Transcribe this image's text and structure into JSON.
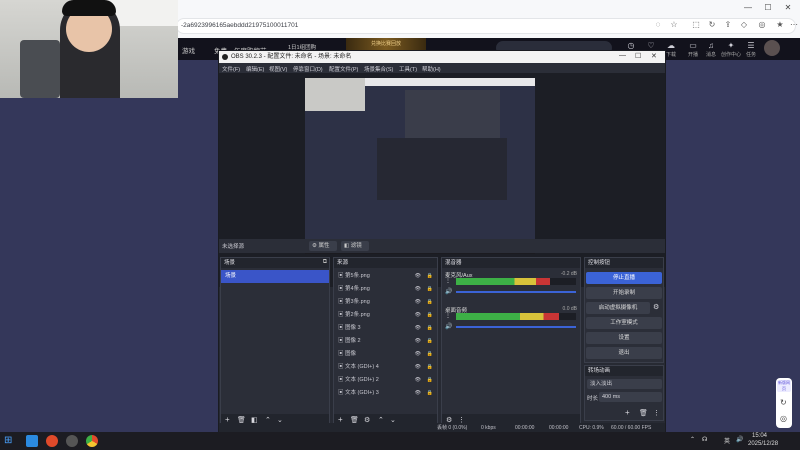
{
  "browser": {
    "address": "-2a6923996165aebddd21975100011701",
    "controls": [
      "minimize-icon",
      "maximize-icon",
      "close-icon"
    ]
  },
  "site": {
    "nav": [
      "游戏",
      "免费",
      "年度购物节",
      "1日1组团购"
    ],
    "banner": "兑换比赛回放",
    "icons": [
      {
        "icon": "clock-icon",
        "label": ""
      },
      {
        "icon": "heart-icon",
        "label": ""
      },
      {
        "icon": "cloud-icon",
        "label": "下载"
      },
      {
        "icon": "broadcast-icon",
        "label": "开播"
      },
      {
        "icon": "bell-icon",
        "label": "消息"
      },
      {
        "icon": "bulb-icon",
        "label": "创作中心"
      },
      {
        "icon": "task-icon",
        "label": "任务"
      }
    ]
  },
  "obs": {
    "title": "OBS 30.2.3 - 配置文件: 未命名 - 场景: 未命名",
    "menu": [
      "文件(F)",
      "编辑(E)",
      "视图(V)",
      "停靠窗口(D)",
      "配置文件(P)",
      "场景集合(S)",
      "工具(T)",
      "帮助(H)"
    ],
    "toolbar": {
      "no_source": "未选择源",
      "properties": "属性",
      "filters": "滤镜"
    },
    "scenes": {
      "header": "场景",
      "items": [
        "场景"
      ]
    },
    "sources": {
      "header": "来源",
      "items": [
        "第5条.png",
        "第4条.png",
        "第3条.png",
        "第2条.png",
        "图像 3",
        "图像 2",
        "图像",
        "文本 (GDI+) 4",
        "文本 (GDI+) 2",
        "文本 (GDI+) 3"
      ]
    },
    "mixer": {
      "header": "混音器",
      "channels": [
        {
          "name": "麦克风/Aux",
          "db": "-0.2 dB",
          "level": 0.78
        },
        {
          "name": "桌面音频",
          "db": "0.0 dB",
          "level": 0.86
        }
      ],
      "ticks": [
        "-60",
        "-55",
        "-50",
        "-45",
        "-40",
        "-35",
        "-30",
        "-25",
        "-20",
        "-15",
        "-10",
        "-5",
        "0"
      ]
    },
    "controls": {
      "header": "控制按钮",
      "buttons": [
        "停止直播",
        "开始录制",
        "启动虚拟摄像机",
        "工作室模式",
        "设置",
        "退出"
      ]
    },
    "transitions": {
      "header": "转场动画",
      "type": "淡入淡出",
      "duration_label": "时长",
      "duration": "400 ms"
    },
    "status": {
      "dropped": "丢帧 0 (0.0%)",
      "kbps": "0 kbps",
      "stream_time": "00:00:00",
      "rec_time": "00:00:00",
      "cpu": "CPU: 0.9%",
      "fps": "60.00 / 60.00 FPS"
    }
  },
  "taskbar": {
    "time": "15:04",
    "date": "2025/12/28",
    "ime": "英"
  },
  "side_widget": {
    "label": "新版网页"
  },
  "colors": {
    "accent": "#3b63d6",
    "active_scene": "#3a55c8",
    "bg": "#34375a"
  }
}
